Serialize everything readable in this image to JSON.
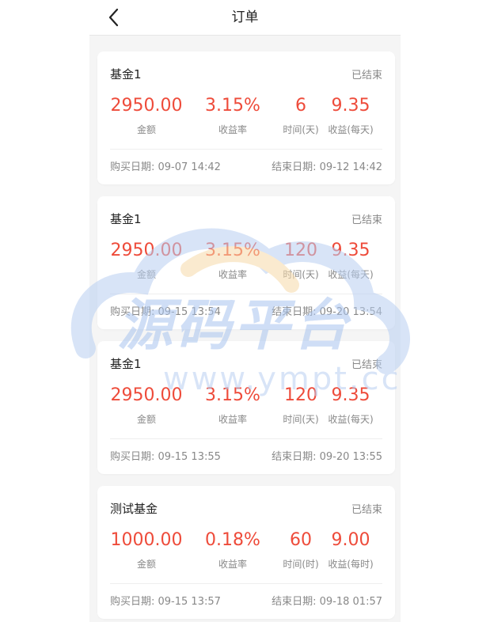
{
  "header": {
    "title": "订单"
  },
  "orders": [
    {
      "name": "基金1",
      "status": "已结束",
      "amount": "2950.00",
      "amount_label": "金额",
      "rate": "3.15%",
      "rate_label": "收益率",
      "duration": "6",
      "duration_label": "时间(天)",
      "income": "9.35",
      "income_label": "收益(每天)",
      "buy_date": "购买日期: 09-07 14:42",
      "end_date": "结束日期: 09-12 14:42"
    },
    {
      "name": "基金1",
      "status": "已结束",
      "amount": "2950.00",
      "amount_label": "金额",
      "rate": "3.15%",
      "rate_label": "收益率",
      "duration": "120",
      "duration_label": "时间(天)",
      "income": "9.35",
      "income_label": "收益(每天)",
      "buy_date": "购买日期: 09-15 13:54",
      "end_date": "结束日期: 09-20 13:54"
    },
    {
      "name": "基金1",
      "status": "已结束",
      "amount": "2950.00",
      "amount_label": "金额",
      "rate": "3.15%",
      "rate_label": "收益率",
      "duration": "120",
      "duration_label": "时间(天)",
      "income": "9.35",
      "income_label": "收益(每天)",
      "buy_date": "购买日期: 09-15 13:55",
      "end_date": "结束日期: 09-20 13:55"
    },
    {
      "name": "测试基金",
      "status": "已结束",
      "amount": "1000.00",
      "amount_label": "金额",
      "rate": "0.18%",
      "rate_label": "收益率",
      "duration": "60",
      "duration_label": "时间(时)",
      "income": "9.00",
      "income_label": "收益(每时)",
      "buy_date": "购买日期: 09-15 13:57",
      "end_date": "结束日期: 09-18 01:57"
    }
  ],
  "watermark": {
    "main": "源码平台",
    "url": "www.ympt.cc"
  },
  "icons": {
    "back": "chevron-left-icon"
  },
  "colors": {
    "accent": "#ee4b3a",
    "muted": "#888888"
  }
}
